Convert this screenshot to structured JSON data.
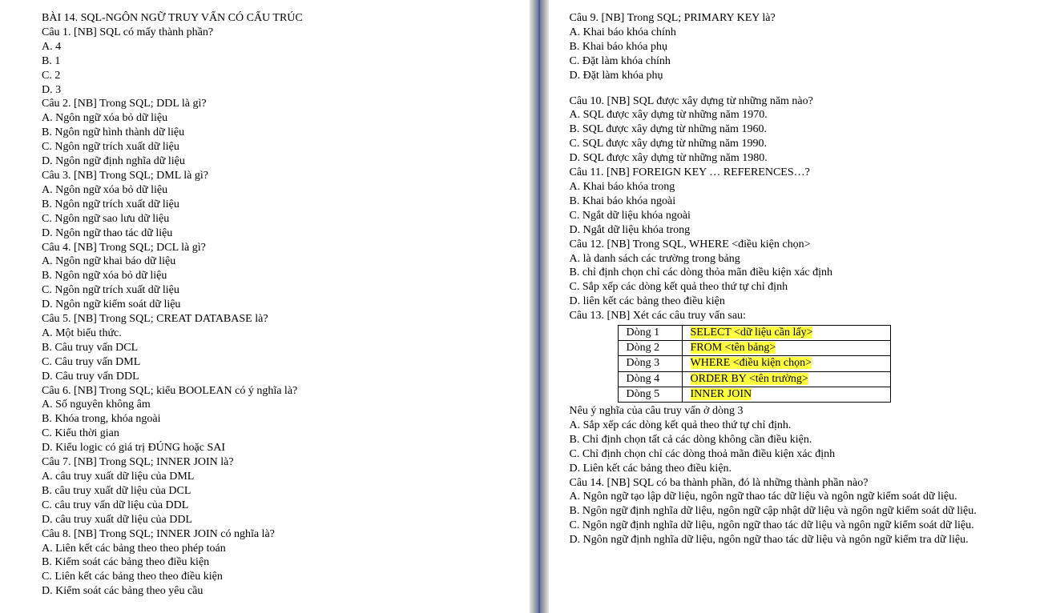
{
  "left": {
    "title": "BÀI 14. SQL-NGÔN NGỮ TRUY VẤN CÓ CẤU TRÚC",
    "q1": "Câu 1. [NB] SQL có mấy thành phần?",
    "q1a": "A. 4",
    "q1b": "B. 1",
    "q1c": "C. 2",
    "q1d": "D. 3",
    "q2": "Câu 2. [NB] Trong SQL; DDL là gì?",
    "q2a": "A. Ngôn ngữ xóa bỏ dữ liệu",
    "q2b": "B. Ngôn ngữ hình thành dữ liệu",
    "q2c": "C. Ngôn ngữ trích xuất dữ liệu",
    "q2d": "D. Ngôn ngữ định nghĩa dữ liệu",
    "q3": "Câu 3. [NB] Trong SQL; DML là gì?",
    "q3a": "A. Ngôn ngữ xóa bỏ dữ liệu",
    "q3b": "B. Ngôn ngữ trích xuất dữ liệu",
    "q3c": "C. Ngôn ngữ sao lưu dữ liệu",
    "q3d": "D. Ngôn ngữ thao tác dữ liệu",
    "q4": "Câu 4. [NB] Trong SQL; DCL là gì?",
    "q4a": "A. Ngôn ngữ khai báo dữ liệu",
    "q4b": "B. Ngôn ngữ xóa bỏ dữ liệu",
    "q4c": "C. Ngôn ngữ trích xuất dữ liệu",
    "q4d": "D. Ngôn ngữ kiểm soát dữ liệu",
    "q5": "Câu 5. [NB] Trong SQL; CREAT DATABASE là?",
    "q5a": "A. Một biểu thức.",
    "q5b": "B. Câu truy vấn DCL",
    "q5c": "C. Câu truy vấn DML",
    "q5d": "D. Câu truy vấn DDL",
    "q6": "Câu 6. [NB] Trong SQL; kiểu BOOLEAN có ý nghĩa là?",
    "q6a": "A. Số nguyên không âm",
    "q6b": "B. Khóa trong, khóa ngoài",
    "q6c": "C. Kiểu thời gian",
    "q6d": "D. Kiểu logic có giá trị ĐÚNG hoặc SAI",
    "q7": "Câu 7. [NB] Trong SQL; INNER JOIN là?",
    "q7a": "A. câu truy xuất dữ liệu của DML",
    "q7b": "B. câu truy xuất dữ liệu của DCL",
    "q7c": "C. câu truy vấn dữ liệu của DDL",
    "q7d": "D. câu truy xuất dữ liệu của DDL",
    "q8": "Câu 8. [NB] Trong SQL; INNER JOIN có nghĩa là?",
    "q8a": "A. Liên kết các bảng theo theo phép toán",
    "q8b": "B. Kiểm soát các bảng theo điều kiện",
    "q8c": "C. Liên kết các bảng theo theo điều kiện",
    "q8d": "D. Kiểm soát các bảng theo yêu cầu"
  },
  "right": {
    "q9": "Câu 9. [NB] Trong SQL; PRIMARY KEY là?",
    "q9a": "A. Khai báo khóa chính",
    "q9b": "B. Khai báo khóa phụ",
    "q9c": "C. Đặt làm khóa chính",
    "q9d": "D. Đặt làm khóa phụ",
    "q10": "Câu 10. [NB] SQL được xây dựng từ những năm nào?",
    "q10a": "A. SQL được xây dựng từ những năm 1970.",
    "q10b": "B. SQL được xây dựng từ những năm 1960.",
    "q10c": "C. SQL được xây dựng từ những năm 1990.",
    "q10d": "D. SQL được xây dựng từ những năm 1980.",
    "q11": " Câu 11. [NB] FOREIGN KEY … REFERENCES…?",
    "q11a": "A. Khai báo khóa trong",
    "q11b": "B. Khai báo khóa ngoài",
    "q11c": "C. Ngắt dữ liệu khóa ngoài",
    "q11d": "D. Ngắt dữ liệu khóa trong",
    "q12": "Câu 12. [NB] Trong SQL, WHERE <điều kiện chọn>",
    "q12a": "A. là danh sách các trường trong bảng",
    "q12b": "B. chỉ định chọn chỉ các dòng thỏa mãn điều kiện xác định",
    "q12c": "C. Sắp xếp các dòng kết quả theo thứ tự chỉ định",
    "q12d": "D. liên kết các bảng theo điều kiện",
    "q13": "Câu 13. [NB] Xét các câu truy vấn sau:",
    "table": {
      "r1c1": "Dòng 1",
      "r1c2": "SELECT <dữ liệu cần lấy>",
      "r2c1": "Dòng 2",
      "r2c2": "FROM <tên bảng>",
      "r3c1": "Dòng 3",
      "r3c2": "WHERE <điều kiện chọn>",
      "r4c1": "Dòng 4",
      "r4c2": "ORDER BY <tên trường>",
      "r5c1": "Dòng 5",
      "r5c2": "INNER JOIN"
    },
    "q13p": "Nêu ý nghĩa của câu truy vấn ở dòng 3",
    "q13a": "A. Sắp xếp các dòng kết quả theo thứ tự chỉ định.",
    "q13b": "B. Chỉ định chọn tất cả các dòng không cần điều kiện.",
    "q13c": "C. Chỉ định chọn chỉ các dòng thoả mãn điều kiện xác định",
    "q13d": "D. Liên kết các bảng theo điều kiện.",
    "q14": "Câu 14. [NB] SQL có ba thành phần, đó là những thành phần nào?",
    "q14a": "A. Ngôn ngữ tạo lập dữ liệu, ngôn ngữ thao tác dữ liệu và ngôn ngữ kiểm soát dữ liệu.",
    "q14b": "B. Ngôn ngữ định nghĩa dữ liệu, ngôn ngữ cập nhật dữ liệu và ngôn ngữ kiểm soát dữ liệu.",
    "q14c": "C. Ngôn ngữ định nghĩa dữ liệu, ngôn ngữ thao tác dữ liệu và ngôn ngữ kiểm soát dữ liệu.",
    "q14d": "D. Ngôn ngữ định nghĩa dữ liệu, ngôn ngữ thao tác dữ liệu và ngôn ngữ kiểm tra dữ liệu."
  }
}
